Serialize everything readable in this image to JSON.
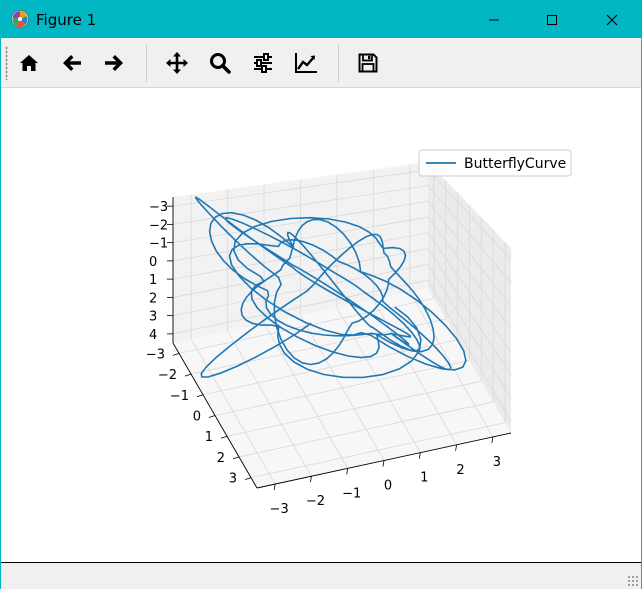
{
  "window": {
    "title": "Figure 1",
    "accent_color": "#00b7c3",
    "controls": [
      "minimize-icon",
      "maximize-icon",
      "close-icon"
    ]
  },
  "toolbar": {
    "buttons": [
      {
        "name": "home",
        "icon": "home-icon"
      },
      {
        "name": "back",
        "icon": "arrow-left-icon"
      },
      {
        "name": "forward",
        "icon": "arrow-right-icon"
      },
      {
        "name": "pan",
        "icon": "move-icon"
      },
      {
        "name": "zoom",
        "icon": "magnifier-icon"
      },
      {
        "name": "subplots",
        "icon": "sliders-icon"
      },
      {
        "name": "edit-axes",
        "icon": "chart-line-icon"
      },
      {
        "name": "save",
        "icon": "floppy-disk-icon"
      }
    ]
  },
  "chart_data": {
    "type": "line",
    "projection": "3d",
    "series": [
      {
        "name": "ButterflyCurve",
        "color": "#1f77b4"
      }
    ],
    "legend": {
      "placement": "top-right"
    },
    "x_ticks": [
      "−3",
      "−2",
      "−1",
      "0",
      "1",
      "2",
      "3"
    ],
    "y_ticks": [
      "−3",
      "−2",
      "−1",
      "0",
      "1",
      "2",
      "3"
    ],
    "z_ticks": [
      "−3",
      "−2",
      "−1",
      "0",
      "1",
      "2",
      "3",
      "4"
    ],
    "xlim": [
      -3,
      3
    ],
    "ylim": [
      -3,
      3
    ],
    "zlim": [
      -3,
      4
    ],
    "grid": true
  }
}
